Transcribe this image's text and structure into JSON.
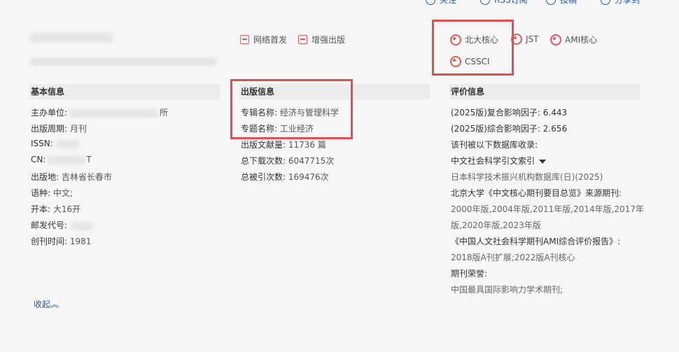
{
  "topbar": {
    "items": [
      "关注",
      "RSS订阅",
      "投稿",
      "分享到"
    ]
  },
  "pub_tags": [
    "网络首发",
    "增强出版"
  ],
  "core_tags": [
    "北大核心",
    "JST",
    "AMI核心",
    "CSSCI"
  ],
  "basic": {
    "title": "基本信息",
    "rows": [
      {
        "k": "主办单位:",
        "v": "所"
      },
      {
        "k": "出版周期:",
        "v": "月刊"
      },
      {
        "k": "ISSN:",
        "v": ""
      },
      {
        "k": "CN:",
        "v": "T"
      },
      {
        "k": "出版地:",
        "v": "吉林省长春市"
      },
      {
        "k": "语种:",
        "v": "中文;"
      },
      {
        "k": "开本:",
        "v": "大16开"
      },
      {
        "k": "邮发代号:",
        "v": ""
      },
      {
        "k": "创刊时间:",
        "v": "1981"
      }
    ],
    "collapse_label": "收起"
  },
  "pub": {
    "title": "出版信息",
    "rows": [
      {
        "k": "专辑名称:",
        "v": "经济与管理科学"
      },
      {
        "k": "专题名称:",
        "v": "工业经济"
      },
      {
        "k": "出版文献量:",
        "v": "11736 篇"
      },
      {
        "k": "总下载次数:",
        "v": "6047715次"
      },
      {
        "k": "总被引次数:",
        "v": "169476次"
      }
    ]
  },
  "eval": {
    "title": "评价信息",
    "lines": [
      "(2025版)复合影响因子: 6.443",
      "(2025版)综合影响因子: 2.656",
      "该刊被以下数据库收录:",
      "中文社会科学引文索引",
      "日本科学技术振兴机构数据库(日)(2025)",
      "北京大学《中文核心期刊要目总览》来源期刊:",
      "2000年版,2004年版,2011年版,2014年版,2017年",
      "版,2020年版,2023年版",
      "《中国人文社会科学期刊AMI综合评价报告》:",
      "2018版A刊扩展;2022版A刊核心",
      "期刊荣誉:",
      "中国最具国际影响力学术期刊;"
    ]
  }
}
